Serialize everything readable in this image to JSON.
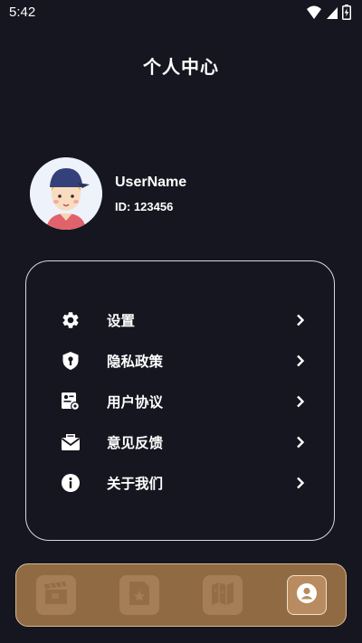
{
  "status_bar": {
    "time": "5:42"
  },
  "page": {
    "title": "个人中心"
  },
  "profile": {
    "username": "UserName",
    "user_id": "ID: 123456"
  },
  "menu": {
    "items": [
      {
        "label": "设置",
        "icon": "gear-icon"
      },
      {
        "label": "隐私政策",
        "icon": "shield-icon"
      },
      {
        "label": "用户协议",
        "icon": "document-settings-icon"
      },
      {
        "label": "意见反馈",
        "icon": "mail-icon"
      },
      {
        "label": "关于我们",
        "icon": "info-icon"
      }
    ]
  },
  "bottom_nav": {
    "tabs": [
      {
        "icon": "clapperboard-icon",
        "active": false
      },
      {
        "icon": "star-document-icon",
        "active": false
      },
      {
        "icon": "map-icon",
        "active": false
      },
      {
        "icon": "profile-icon",
        "active": true
      }
    ]
  },
  "colors": {
    "background": "#151620",
    "nav_background": "#8f6a43",
    "nav_active": "#b88c60",
    "text": "#ffffff"
  }
}
